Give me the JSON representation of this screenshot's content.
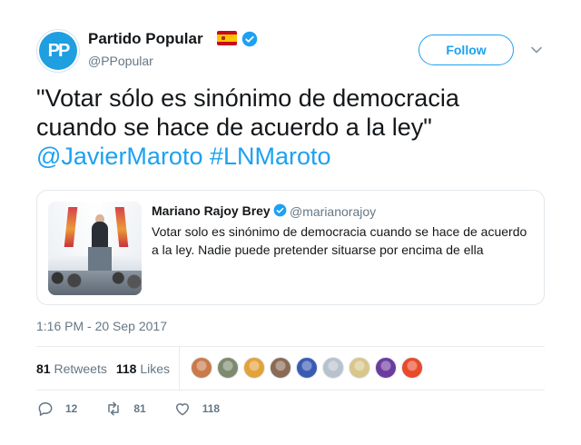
{
  "author": {
    "avatar_text": "PP",
    "name": "Partido Popular",
    "handle": "@PPopular"
  },
  "follow_label": "Follow",
  "tweet": {
    "line1": "\"Votar sólo es sinónimo de democracia",
    "line2": "cuando se hace de acuerdo a la ley\"",
    "mention": "@JavierMaroto",
    "hashtag": "#LNMaroto"
  },
  "quoted": {
    "name": "Mariano Rajoy Brey",
    "handle": "@marianorajoy",
    "text": "Votar solo es sinónimo de democracia cuando se hace de acuerdo a la ley. Nadie puede pretender situarse por encima de ella"
  },
  "timestamp": "1:16 PM - 20 Sep 2017",
  "stats": {
    "retweets_count": "81",
    "retweets_label": "Retweets",
    "likes_count": "118",
    "likes_label": "Likes"
  },
  "likers": [
    {
      "color": "#c97a4a"
    },
    {
      "color": "#7d8a6e"
    },
    {
      "color": "#e2a23a"
    },
    {
      "color": "#8a6b55"
    },
    {
      "color": "#3b5bb3"
    },
    {
      "color": "#b8c2cc"
    },
    {
      "color": "#d8c68a"
    },
    {
      "color": "#6b3c9e"
    },
    {
      "color": "#e84a2a"
    }
  ],
  "actions": {
    "reply_count": "12",
    "retweet_count": "81",
    "like_count": "118"
  },
  "colors": {
    "accent": "#1da1f2",
    "text": "#14171a",
    "muted": "#657786"
  }
}
